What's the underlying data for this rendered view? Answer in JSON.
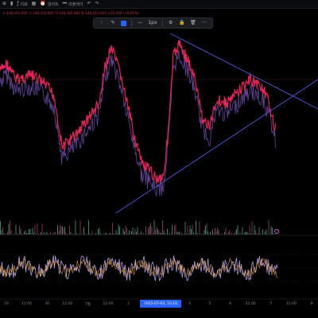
{
  "toolbar": {
    "items": [
      {
        "icon": "plus-icon",
        "glyph": "⊕",
        "label": ""
      },
      {
        "icon": "bar-chart-icon",
        "glyph": "▮",
        "label": ""
      },
      {
        "icon": "indicator-icon",
        "glyph": "ƒ",
        "label": "지표"
      },
      {
        "icon": "grid-icon",
        "glyph": "▦",
        "label": ""
      },
      {
        "icon": "alert-icon",
        "glyph": "⏰",
        "label": "얼러트"
      },
      {
        "icon": "replay-icon",
        "glyph": "⏮",
        "label": "리플레이"
      },
      {
        "icon": "undo-icon",
        "glyph": "↶",
        "label": ""
      },
      {
        "icon": "redo-icon",
        "glyph": "↷",
        "label": ""
      }
    ]
  },
  "ohlc_text": "시 148,391,000 고 148,700,000 저 148,380,000 종 148,411,000 +11,000 (+0.01%)",
  "drawing_toolbar": [
    {
      "icon": "drag-handle-icon",
      "glyph": "⋮"
    },
    {
      "icon": "pencil-icon",
      "glyph": "✎"
    },
    {
      "icon": "line-color-swatch",
      "glyph": ""
    },
    {
      "icon": "separator",
      "glyph": ""
    },
    {
      "icon": "line-style-icon",
      "glyph": "—"
    },
    {
      "icon": "line-width-label",
      "glyph": "1px"
    },
    {
      "icon": "separator",
      "glyph": ""
    },
    {
      "icon": "settings-icon",
      "glyph": "⚙"
    },
    {
      "icon": "lock-icon",
      "glyph": "🔒"
    },
    {
      "icon": "trash-icon",
      "glyph": "🗑"
    },
    {
      "icon": "more-icon",
      "glyph": "···"
    }
  ],
  "x_axis": {
    "ticks": [
      "29",
      "12:00",
      "30",
      "12:00",
      "7월",
      "12:00",
      "2",
      "12:00",
      "3",
      "4",
      "5",
      "6",
      "12:00",
      "7",
      "12:00",
      "8"
    ],
    "highlight": "2025-07-03, 10:10"
  },
  "colors": {
    "price_line": "#e0265c",
    "price_line_alt": "#7e57c2",
    "trendline": "#4a5bd4",
    "oscillator_1": "#b39ddb",
    "oscillator_2": "#ffb74d",
    "time_badge": "#2962ff",
    "background": "#000000"
  }
}
